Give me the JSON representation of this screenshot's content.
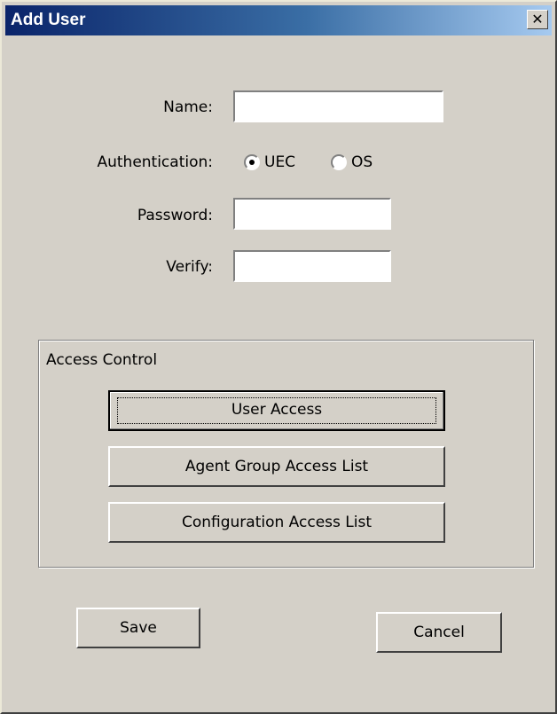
{
  "window": {
    "title": "Add User",
    "close_glyph": "✕"
  },
  "form": {
    "name_label": "Name:",
    "name_value": "",
    "auth_label": "Authentication:",
    "auth_options": [
      {
        "label": "UEC",
        "selected": true
      },
      {
        "label": "OS",
        "selected": false
      }
    ],
    "password_label": "Password:",
    "password_value": "",
    "verify_label": "Verify:",
    "verify_value": ""
  },
  "access_control": {
    "title": "Access Control",
    "buttons": {
      "user_access": "User Access",
      "agent_group": "Agent Group Access List",
      "configuration": "Configuration Access List"
    }
  },
  "footer": {
    "save": "Save",
    "cancel": "Cancel"
  }
}
